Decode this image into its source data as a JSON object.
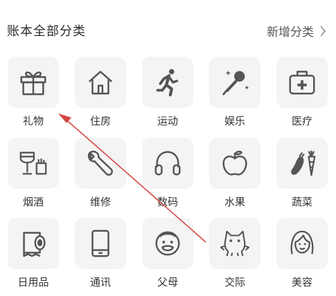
{
  "header": {
    "title": "账本全部分类",
    "add_label": "新增分类"
  },
  "categories": [
    {
      "label": "礼物",
      "icon": "gift-icon"
    },
    {
      "label": "住房",
      "icon": "house-icon"
    },
    {
      "label": "运动",
      "icon": "running-icon"
    },
    {
      "label": "娱乐",
      "icon": "microphone-icon"
    },
    {
      "label": "医疗",
      "icon": "medical-kit-icon"
    },
    {
      "label": "烟酒",
      "icon": "wine-cigarette-icon"
    },
    {
      "label": "维修",
      "icon": "wrench-icon"
    },
    {
      "label": "数码",
      "icon": "headphones-icon"
    },
    {
      "label": "水果",
      "icon": "apple-icon"
    },
    {
      "label": "蔬菜",
      "icon": "vegetables-icon"
    },
    {
      "label": "日用品",
      "icon": "toilet-paper-icon"
    },
    {
      "label": "通讯",
      "icon": "phone-icon"
    },
    {
      "label": "父母",
      "icon": "elder-face-icon"
    },
    {
      "label": "交际",
      "icon": "social-cat-icon"
    },
    {
      "label": "美容",
      "icon": "woman-face-icon"
    }
  ],
  "colors": {
    "icon_stroke": "#555555",
    "tile_bg": "#f4f4f4",
    "annotation_arrow": "#d64545"
  }
}
